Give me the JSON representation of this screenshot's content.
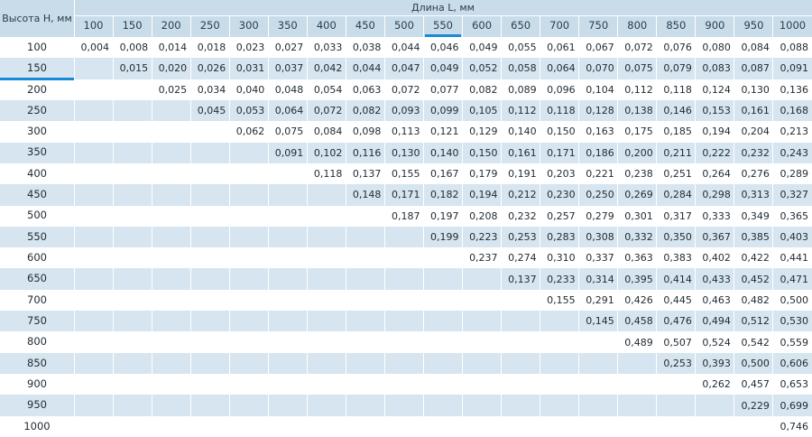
{
  "table": {
    "corner_label": "Высота H, мм",
    "length_caption": "Длина L, мм",
    "lengths": [
      "100",
      "150",
      "200",
      "250",
      "300",
      "350",
      "400",
      "450",
      "500",
      "550",
      "600",
      "650",
      "700",
      "750",
      "800",
      "850",
      "900",
      "950",
      "1000"
    ],
    "selected_length": "550",
    "selected_height": "150",
    "rows": [
      {
        "height": "100",
        "values": [
          "0,004",
          "0,008",
          "0,014",
          "0,018",
          "0,023",
          "0,027",
          "0,033",
          "0,038",
          "0,044",
          "0,046",
          "0,049",
          "0,055",
          "0,061",
          "0,067",
          "0,072",
          "0,076",
          "0,080",
          "0,084",
          "0,088"
        ]
      },
      {
        "height": "150",
        "values": [
          "",
          "0,015",
          "0,020",
          "0,026",
          "0,031",
          "0,037",
          "0,042",
          "0,044",
          "0,047",
          "0,049",
          "0,052",
          "0,058",
          "0,064",
          "0,070",
          "0,075",
          "0,079",
          "0,083",
          "0,087",
          "0,091"
        ]
      },
      {
        "height": "200",
        "values": [
          "",
          "",
          "0,025",
          "0,034",
          "0,040",
          "0,048",
          "0,054",
          "0,063",
          "0,072",
          "0,077",
          "0,082",
          "0,089",
          "0,096",
          "0,104",
          "0,112",
          "0,118",
          "0,124",
          "0,130",
          "0,136"
        ]
      },
      {
        "height": "250",
        "values": [
          "",
          "",
          "",
          "0,045",
          "0,053",
          "0,064",
          "0,072",
          "0,082",
          "0,093",
          "0,099",
          "0,105",
          "0,112",
          "0,118",
          "0,128",
          "0,138",
          "0,146",
          "0,153",
          "0,161",
          "0,168"
        ]
      },
      {
        "height": "300",
        "values": [
          "",
          "",
          "",
          "",
          "0,062",
          "0,075",
          "0,084",
          "0,098",
          "0,113",
          "0,121",
          "0,129",
          "0,140",
          "0,150",
          "0,163",
          "0,175",
          "0,185",
          "0,194",
          "0,204",
          "0,213"
        ]
      },
      {
        "height": "350",
        "values": [
          "",
          "",
          "",
          "",
          "",
          "0,091",
          "0,102",
          "0,116",
          "0,130",
          "0,140",
          "0,150",
          "0,161",
          "0,171",
          "0,186",
          "0,200",
          "0,211",
          "0,222",
          "0,232",
          "0,243"
        ]
      },
      {
        "height": "400",
        "values": [
          "",
          "",
          "",
          "",
          "",
          "",
          "0,118",
          "0,137",
          "0,155",
          "0,167",
          "0,179",
          "0,191",
          "0,203",
          "0,221",
          "0,238",
          "0,251",
          "0,264",
          "0,276",
          "0,289"
        ]
      },
      {
        "height": "450",
        "values": [
          "",
          "",
          "",
          "",
          "",
          "",
          "",
          "0,148",
          "0,171",
          "0,182",
          "0,194",
          "0,212",
          "0,230",
          "0,250",
          "0,269",
          "0,284",
          "0,298",
          "0,313",
          "0,327"
        ]
      },
      {
        "height": "500",
        "values": [
          "",
          "",
          "",
          "",
          "",
          "",
          "",
          "",
          "0,187",
          "0,197",
          "0,208",
          "0,232",
          "0,257",
          "0,279",
          "0,301",
          "0,317",
          "0,333",
          "0,349",
          "0,365"
        ]
      },
      {
        "height": "550",
        "values": [
          "",
          "",
          "",
          "",
          "",
          "",
          "",
          "",
          "",
          "0,199",
          "0,223",
          "0,253",
          "0,283",
          "0,308",
          "0,332",
          "0,350",
          "0,367",
          "0,385",
          "0,403"
        ]
      },
      {
        "height": "600",
        "values": [
          "",
          "",
          "",
          "",
          "",
          "",
          "",
          "",
          "",
          "",
          "0,237",
          "0,274",
          "0,310",
          "0,337",
          "0,363",
          "0,383",
          "0,402",
          "0,422",
          "0,441"
        ]
      },
      {
        "height": "650",
        "values": [
          "",
          "",
          "",
          "",
          "",
          "",
          "",
          "",
          "",
          "",
          "",
          "0,137",
          "0,233",
          "0,314",
          "0,395",
          "0,414",
          "0,433",
          "0,452",
          "0,471"
        ]
      },
      {
        "height": "700",
        "values": [
          "",
          "",
          "",
          "",
          "",
          "",
          "",
          "",
          "",
          "",
          "",
          "",
          "0,155",
          "0,291",
          "0,426",
          "0,445",
          "0,463",
          "0,482",
          "0,500"
        ]
      },
      {
        "height": "750",
        "values": [
          "",
          "",
          "",
          "",
          "",
          "",
          "",
          "",
          "",
          "",
          "",
          "",
          "",
          "0,145",
          "0,458",
          "0,476",
          "0,494",
          "0,512",
          "0,530"
        ]
      },
      {
        "height": "800",
        "values": [
          "",
          "",
          "",
          "",
          "",
          "",
          "",
          "",
          "",
          "",
          "",
          "",
          "",
          "",
          "0,489",
          "0,507",
          "0,524",
          "0,542",
          "0,559"
        ]
      },
      {
        "height": "850",
        "values": [
          "",
          "",
          "",
          "",
          "",
          "",
          "",
          "",
          "",
          "",
          "",
          "",
          "",
          "",
          "",
          "0,253",
          "0,393",
          "0,500",
          "0,606"
        ]
      },
      {
        "height": "900",
        "values": [
          "",
          "",
          "",
          "",
          "",
          "",
          "",
          "",
          "",
          "",
          "",
          "",
          "",
          "",
          "",
          "",
          "0,262",
          "0,457",
          "0,653"
        ]
      },
      {
        "height": "950",
        "values": [
          "",
          "",
          "",
          "",
          "",
          "",
          "",
          "",
          "",
          "",
          "",
          "",
          "",
          "",
          "",
          "",
          "",
          "0,229",
          "0,699"
        ]
      },
      {
        "height": "1000",
        "values": [
          "",
          "",
          "",
          "",
          "",
          "",
          "",
          "",
          "",
          "",
          "",
          "",
          "",
          "",
          "",
          "",
          "",
          "",
          "0,746"
        ]
      }
    ]
  },
  "colors": {
    "header_bg": "#c8dce9",
    "stripe_bg": "#d6e5ef",
    "marker": "#1a8ad6"
  }
}
